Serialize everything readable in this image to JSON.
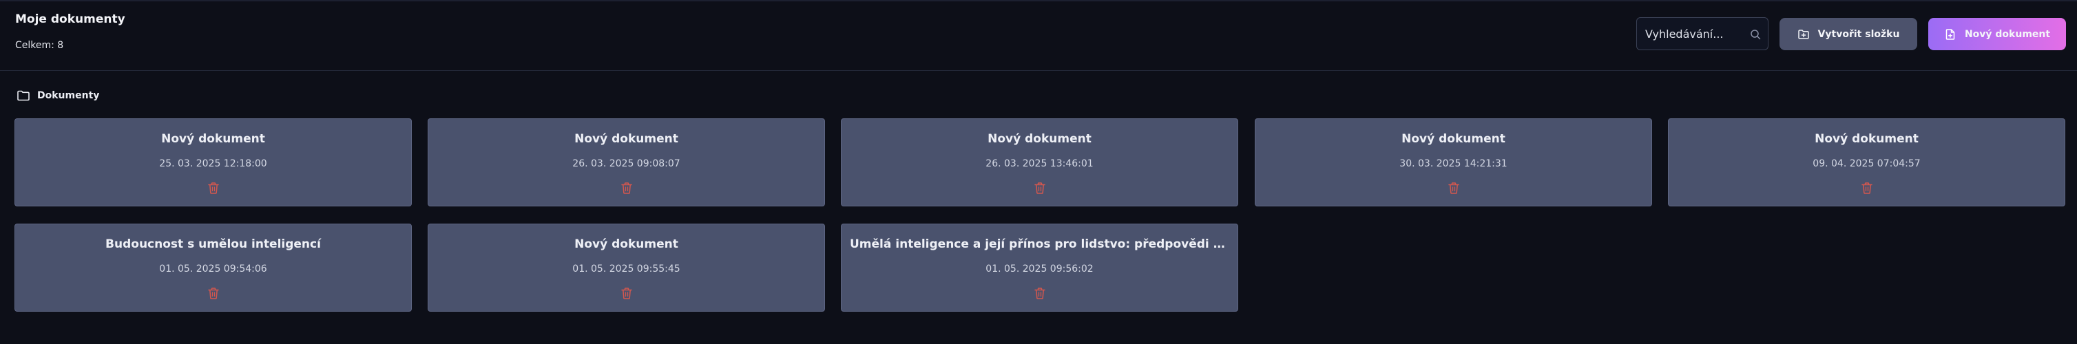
{
  "header": {
    "title": "Moje dokumenty",
    "total": "Celkem: 8"
  },
  "search": {
    "value": "Vyhledávání..."
  },
  "actions": {
    "create_folder": "Vytvořit složku",
    "new_document": "Nový dokument"
  },
  "breadcrumb": {
    "label": "Dokumenty"
  },
  "colors": {
    "background": "#0d0f18",
    "card": "#4a526d",
    "accent_gradient_start": "#9b6cf5",
    "accent_gradient_end": "#e36ee6",
    "delete": "#d4574e"
  },
  "documents": [
    {
      "title": "Nový dokument",
      "date": "25. 03. 2025 12:18:00"
    },
    {
      "title": "Nový dokument",
      "date": "26. 03. 2025 09:08:07"
    },
    {
      "title": "Nový dokument",
      "date": "26. 03. 2025 13:46:01"
    },
    {
      "title": "Nový dokument",
      "date": "30. 03. 2025 14:21:31"
    },
    {
      "title": "Nový dokument",
      "date": "09. 04. 2025 07:04:57"
    },
    {
      "title": "Budoucnost s umělou inteligencí",
      "date": "01. 05. 2025 09:54:06"
    },
    {
      "title": "Nový dokument",
      "date": "01. 05. 2025 09:55:45"
    },
    {
      "title": "Umělá inteligence a její přínos pro lidstvo: předpovědi na příští desetiletí",
      "date": "01. 05. 2025 09:56:02"
    }
  ]
}
